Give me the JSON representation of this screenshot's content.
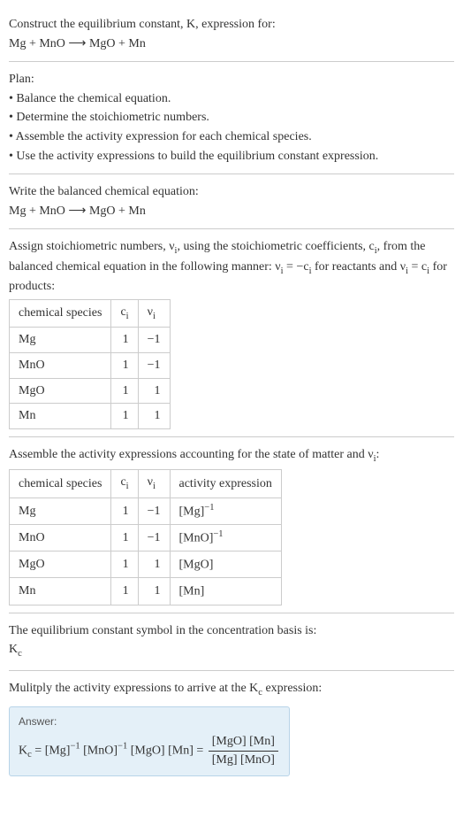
{
  "intro": {
    "line1": "Construct the equilibrium constant, K, expression for:",
    "line2": "Mg + MnO ⟶ MgO + Mn"
  },
  "plan": {
    "heading": "Plan:",
    "items": [
      "• Balance the chemical equation.",
      "• Determine the stoichiometric numbers.",
      "• Assemble the activity expression for each chemical species.",
      "• Use the activity expressions to build the equilibrium constant expression."
    ]
  },
  "balanced": {
    "heading": "Write the balanced chemical equation:",
    "equation": "Mg + MnO ⟶ MgO + Mn"
  },
  "stoich": {
    "text_a": "Assign stoichiometric numbers, ν",
    "text_b": ", using the stoichiometric coefficients, c",
    "text_c": ", from the balanced chemical equation in the following manner: ν",
    "text_d": " = −c",
    "text_e": " for reactants and ν",
    "text_f": " = c",
    "text_g": " for products:",
    "headers": {
      "species": "chemical species",
      "ci": "c",
      "vi": "ν"
    },
    "rows": [
      {
        "species": "Mg",
        "ci": "1",
        "vi": "−1"
      },
      {
        "species": "MnO",
        "ci": "1",
        "vi": "−1"
      },
      {
        "species": "MgO",
        "ci": "1",
        "vi": "1"
      },
      {
        "species": "Mn",
        "ci": "1",
        "vi": "1"
      }
    ]
  },
  "activity": {
    "text_a": "Assemble the activity expressions accounting for the state of matter and ν",
    "text_b": ":",
    "headers": {
      "species": "chemical species",
      "ci": "c",
      "vi": "ν",
      "act": "activity expression"
    },
    "rows": [
      {
        "species": "Mg",
        "ci": "1",
        "vi": "−1",
        "base": "[Mg]",
        "exp": "−1"
      },
      {
        "species": "MnO",
        "ci": "1",
        "vi": "−1",
        "base": "[MnO]",
        "exp": "−1"
      },
      {
        "species": "MgO",
        "ci": "1",
        "vi": "1",
        "base": "[MgO]",
        "exp": ""
      },
      {
        "species": "Mn",
        "ci": "1",
        "vi": "1",
        "base": "[Mn]",
        "exp": ""
      }
    ]
  },
  "symbol": {
    "line1": "The equilibrium constant symbol in the concentration basis is:",
    "line2_a": "K",
    "line2_b": "c"
  },
  "multiply": {
    "text_a": "Mulitply the activity expressions to arrive at the K",
    "text_b": " expression:"
  },
  "answer": {
    "label": "Answer:",
    "lhs_a": "K",
    "lhs_b": "c",
    "mid_a": " = [Mg]",
    "mid_b": " [MnO]",
    "mid_c": " [MgO] [Mn] = ",
    "exp": "−1",
    "frac_top": "[MgO] [Mn]",
    "frac_bot": "[Mg] [MnO]"
  }
}
